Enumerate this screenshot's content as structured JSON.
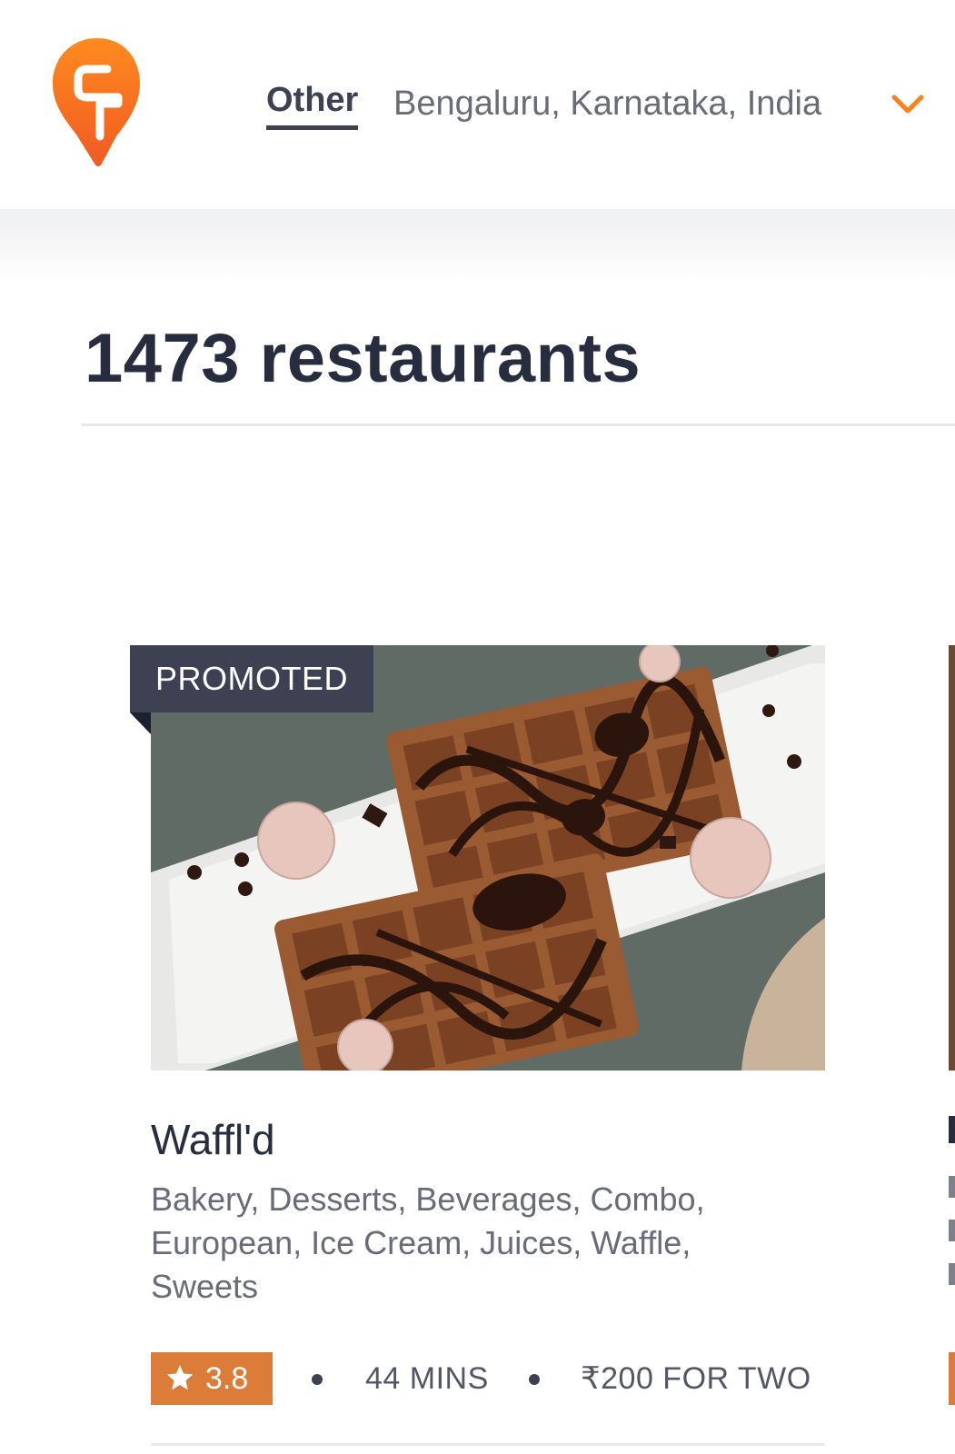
{
  "header": {
    "location_type": "Other",
    "location_address": "Bengaluru, Karnataka, India",
    "brand_color": "#fc8019"
  },
  "results": {
    "count_label": "1473 restaurants"
  },
  "restaurants": [
    {
      "badge": "PROMOTED",
      "name": "Waffl'd",
      "cuisines": "Bakery, Desserts, Beverages, Combo, European, Ice Cream, Juices, Waffle, Sweets",
      "rating": "3.8",
      "delivery_time": "44 MINS",
      "cost_for_two": "₹200 FOR TWO",
      "rating_color": "#db7c38"
    }
  ]
}
